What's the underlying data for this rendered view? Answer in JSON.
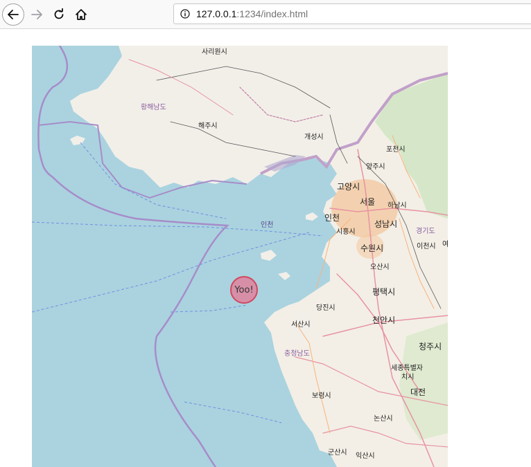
{
  "browser": {
    "url_host": "127.0.0.1",
    "url_path": ":1234/index.html"
  },
  "map": {
    "labels": {
      "sariwon": "사리원시",
      "hwanghae": "황해남도",
      "haeju": "해주시",
      "kaesong": "개성시",
      "pocheon": "포천시",
      "yangju": "양주시",
      "goyang": "고양시",
      "seoul": "서울",
      "hanam": "하남시",
      "incheon": "인천",
      "incheon_sea": "인천",
      "siheung": "시흥시",
      "seongnam": "성남시",
      "gyeonggi": "경기도",
      "suwon": "수원시",
      "icheon": "이천시",
      "yeo": "여",
      "osan": "오산시",
      "pyeongtaek": "평택시",
      "dangjin": "당진시",
      "cheonan": "천안시",
      "seosan": "서산시",
      "chungnam": "충청남도",
      "cheongju": "청주시",
      "sejong1": "세종특별자",
      "sejong2": "치시",
      "daejeon": "대전",
      "boryeong": "보령시",
      "nonsan": "논산시",
      "gunsan": "군산시",
      "iksan": "익산시"
    },
    "marker_label": "Yoo!"
  }
}
